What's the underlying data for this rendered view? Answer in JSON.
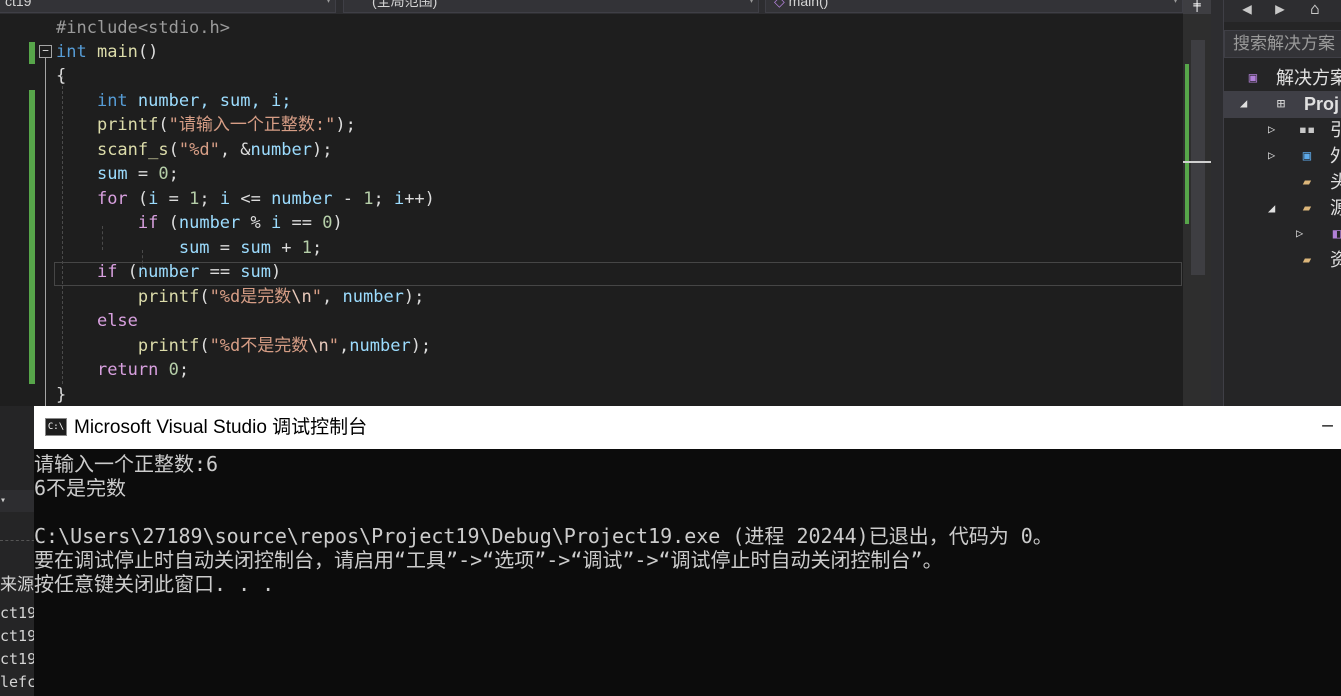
{
  "topbar": {
    "project_dropdown": "ct19",
    "scope_dropdown": "(全局范围)",
    "function_dropdown": "main()"
  },
  "editor": {
    "line_include": "#include<stdio.h>",
    "kw_int": "int",
    "fn_main": "main",
    "parens": "()",
    "brace_open": "{",
    "brace_close": "}",
    "decl_rest": " number, sum, i;",
    "kw_for": "for",
    "kw_if": "if",
    "kw_else": "else",
    "kw_return": "return",
    "fn_printf": "printf",
    "fn_scanf": "scanf_s",
    "str_prompt": "\"请输入一个正整数:\"",
    "str_fmt": "\"%d\"",
    "str_perfect_a": "\"%d是完数",
    "str_not_perfect_a": "\"%d不是完数",
    "esc_newline": "\\n",
    "quote": "\"",
    "var_number": "number",
    "var_sum": "sum",
    "var_i": "i"
  },
  "solution_explorer": {
    "search_placeholder": "搜索解决方案",
    "solution_label": "解决方案",
    "project_label": "Proj",
    "item_references": "引",
    "item_external": "外",
    "item_headers": "头",
    "item_sources": "源",
    "item_resources": "资"
  },
  "left_panel": {
    "source_label": "来源",
    "row1": "ct19",
    "row2": "ct19",
    "row3": "ct19",
    "row4": "lefc"
  },
  "console": {
    "title": "Microsoft Visual Studio 调试控制台",
    "lines": [
      "请输入一个正整数:6",
      "6不是完数",
      "",
      "C:\\Users\\27189\\source\\repos\\Project19\\Debug\\Project19.exe (进程 20244)已退出，代码为 0。",
      "要在调试停止时自动关闭控制台，请启用“工具”->“选项”->“调试”->“调试停止时自动关闭控制台”。",
      "按任意键关闭此窗口. . ."
    ]
  },
  "colors": {
    "keyword": "#569cd6",
    "function": "#dcdcaa",
    "string": "#d69d85",
    "variable": "#9cdcfe",
    "number": "#b5cea8",
    "change_marker": "#57a64a"
  }
}
